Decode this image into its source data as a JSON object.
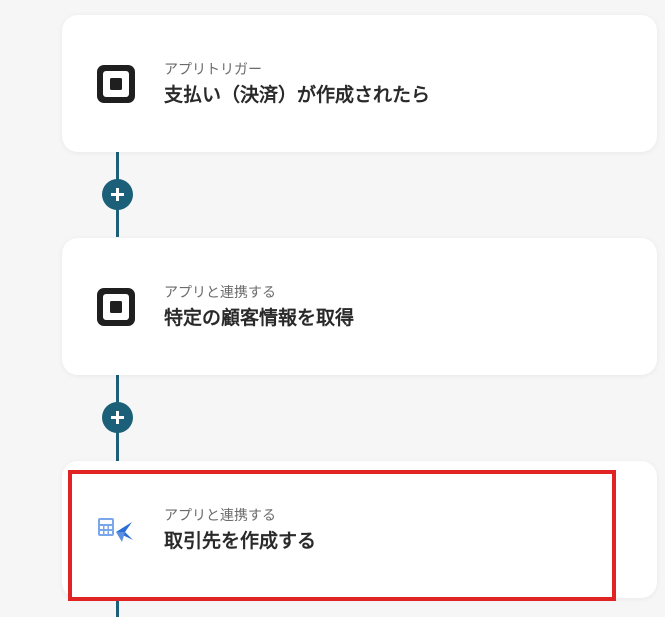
{
  "steps": [
    {
      "subtitle": "アプリトリガー",
      "title": "支払い（決済）が作成されたら",
      "icon": "square-logo-icon"
    },
    {
      "subtitle": "アプリと連携する",
      "title": "特定の顧客情報を取得",
      "icon": "square-logo-icon"
    },
    {
      "subtitle": "アプリと連携する",
      "title": "取引先を作成する",
      "icon": "calculator-app-icon"
    }
  ],
  "colors": {
    "connector": "#1c5f78",
    "highlight": "#e02424",
    "background": "#f6f6f7"
  }
}
